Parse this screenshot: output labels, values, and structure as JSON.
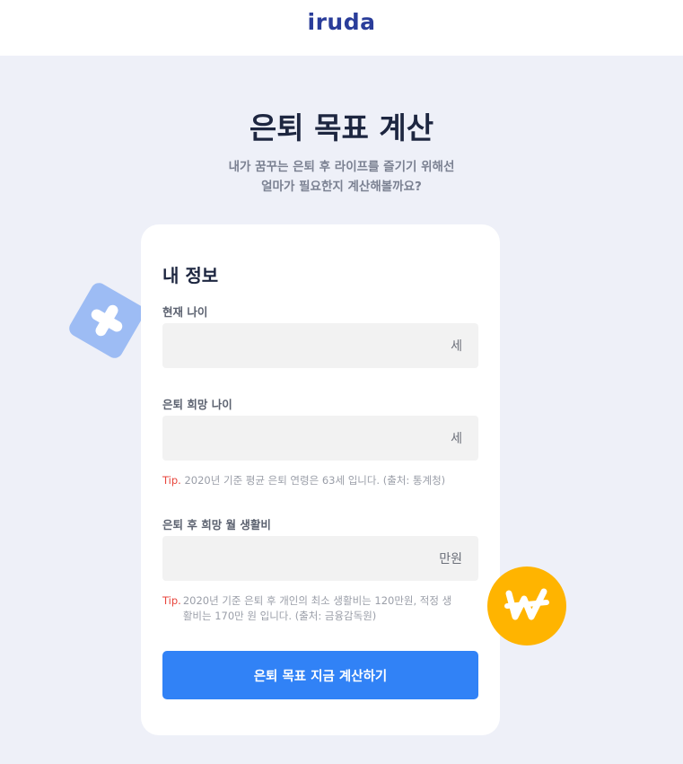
{
  "header": {
    "logo_text": "iruda"
  },
  "hero": {
    "title": "은퇴 목표 계산",
    "subtitle_line1": "내가 꿈꾸는 은퇴 후 라이프를 즐기기 위해선",
    "subtitle_line2": "얼마가 필요한지 계산해볼까요?"
  },
  "form": {
    "section_title": "내 정보",
    "current_age": {
      "label": "현재 나이",
      "value": "",
      "unit": "세"
    },
    "retire_age": {
      "label": "은퇴 희망 나이",
      "value": "",
      "unit": "세"
    },
    "retire_age_tip": {
      "tag": "Tip.",
      "text": "2020년 기준 평균 은퇴 연령은 63세 입니다. (출처: 통계청)"
    },
    "monthly_cost": {
      "label": "은퇴 후 희망 월 생활비",
      "value": "",
      "unit": "만원"
    },
    "monthly_cost_tip": {
      "tag": "Tip.",
      "text": "2020년 기준 은퇴 후 개인의 최소 생활비는 120만원, 적정 생활비는 170만 원 입니다. (출처: 금융감독원)"
    },
    "submit_label": "은퇴 목표 지금 계산하기"
  },
  "decorations": {
    "left_icon": "plus-icon",
    "right_icon": "won-coin-icon",
    "colors": {
      "plus": "#9dbcf4",
      "coin": "#ffb400",
      "cta": "#3182f6",
      "tip_tag": "#e8453c"
    }
  }
}
